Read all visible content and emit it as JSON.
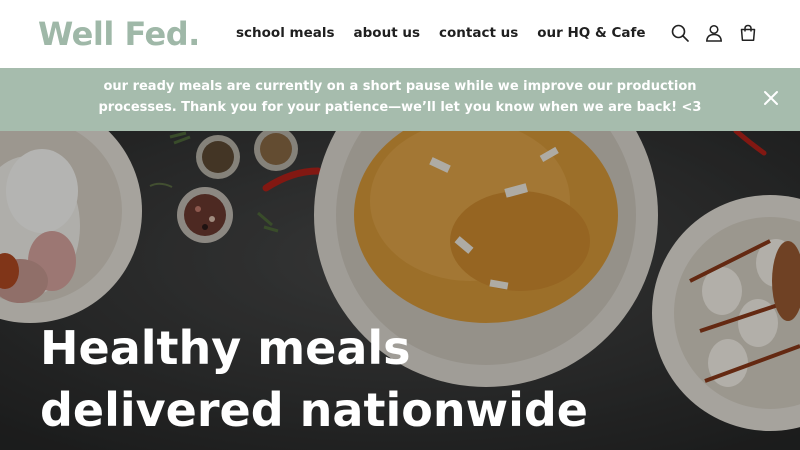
{
  "brand": {
    "logo_text": "Well Fed.",
    "logo_color": "#9fb8a8"
  },
  "nav": {
    "items": [
      {
        "label": "school meals"
      },
      {
        "label": "about us"
      },
      {
        "label": "contact us"
      },
      {
        "label": "our HQ & Cafe"
      }
    ]
  },
  "header_icons": [
    "search-icon",
    "account-icon",
    "cart-icon"
  ],
  "announcement": {
    "line1": "our ready meals are currently on a short pause while we improve our production",
    "line2": "processes. Thank you for your patience—we’ll let you know when we are back! <3",
    "background": "#a6bcad",
    "close_icon": "close-icon"
  },
  "hero": {
    "title_line1": "Healthy meals",
    "title_line2": "delivered nationwide"
  }
}
